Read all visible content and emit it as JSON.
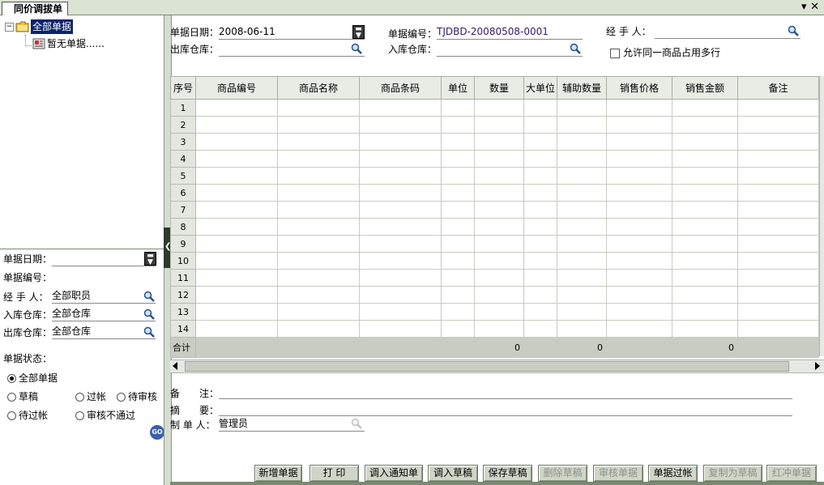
{
  "window": {
    "tab_title": "同价调拔单",
    "ctrl_menu": "▾",
    "ctrl_close": "✕"
  },
  "tree": {
    "root_label": "全部单据",
    "child_label": "暂无单据......"
  },
  "filter": {
    "date_label": "单据日期：",
    "date_value": "",
    "number_label": "单据编号：",
    "number_value": "",
    "handler_label": "经 手 人：",
    "handler_value": "全部职员",
    "in_wh_label": "入库仓库：",
    "in_wh_value": "全部仓库",
    "out_wh_label": "出库仓库：",
    "out_wh_value": "全部仓库",
    "status_label": "单据状态：",
    "status_options": [
      "全部单据",
      "草稿",
      "过帐",
      "待审核",
      "待过帐",
      "审核不通过"
    ],
    "status_selected": "全部单据",
    "go_label": "GO"
  },
  "header": {
    "date_label": "单据日期：",
    "date_value": "2008-06-11",
    "number_label": "单据编号：",
    "number_value": "TJDBD-20080508-0001",
    "handler_label": "经 手 人：",
    "handler_value": "",
    "out_wh_label": "出库仓库：",
    "out_wh_value": "",
    "in_wh_label": "入库仓库：",
    "in_wh_value": "",
    "allow_multi_label": "允许同一商品占用多行"
  },
  "grid": {
    "columns": [
      "序号",
      "商品编号",
      "商品名称",
      "商品条码",
      "单位",
      "数量",
      "大单位",
      "辅助数量",
      "销售价格",
      "销售金额",
      "备注"
    ],
    "rows": [
      "1",
      "2",
      "3",
      "4",
      "5",
      "6",
      "7",
      "8",
      "9",
      "10",
      "11",
      "12",
      "13",
      "14"
    ],
    "total_label": "合计",
    "total_qty": "0",
    "total_aux_qty": "0",
    "total_amount": "0"
  },
  "footer": {
    "remark_label": "备　　注：",
    "summary_label": "摘　　要：",
    "maker_label": "制 单 人：",
    "maker_value": "管理员"
  },
  "buttons": [
    {
      "label": "新增单据",
      "enabled": true
    },
    {
      "label": "打 印",
      "enabled": true
    },
    {
      "label": "调入通知单",
      "enabled": true
    },
    {
      "label": "调入草稿",
      "enabled": true
    },
    {
      "label": "保存草稿",
      "enabled": true
    },
    {
      "label": "删除草稿",
      "enabled": false
    },
    {
      "label": "审核单据",
      "enabled": false
    },
    {
      "label": "单据过帐",
      "enabled": true
    },
    {
      "label": "复制为草稿",
      "enabled": false
    },
    {
      "label": "红冲单据",
      "enabled": false
    }
  ],
  "icons": {
    "search": "magnifier-icon",
    "dropdown": "dropdown-icon",
    "folder": "folder-icon",
    "doc": "document-icon"
  },
  "colors": {
    "selection": "#0a246a",
    "panel_bg": "#e3e7df",
    "button_bg": "#cfd6c8"
  }
}
